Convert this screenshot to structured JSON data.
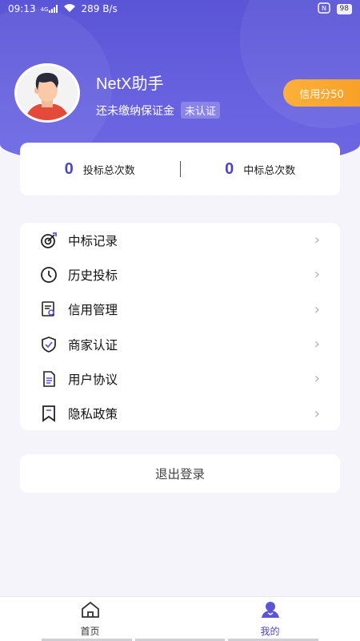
{
  "status_bar": {
    "time": "09:13",
    "signal_text": "4G",
    "net_speed": "289 B/s",
    "battery": "98"
  },
  "profile": {
    "username": "NetX助手",
    "deposit_status": "还未缴纳保证金",
    "verify_status": "未认证",
    "credit_label": "信用分50"
  },
  "stats": [
    {
      "value": "0",
      "label": "投标总次数"
    },
    {
      "value": "0",
      "label": "中标总次数"
    }
  ],
  "menu": [
    {
      "label": "中标记录",
      "icon": "target-icon"
    },
    {
      "label": "历史投标",
      "icon": "clock-icon"
    },
    {
      "label": "信用管理",
      "icon": "certificate-icon"
    },
    {
      "label": "商家认证",
      "icon": "shield-check-icon"
    },
    {
      "label": "用户协议",
      "icon": "document-icon"
    },
    {
      "label": "隐私政策",
      "icon": "bookmark-icon"
    }
  ],
  "logout_label": "退出登录",
  "tabs": [
    {
      "label": "首页",
      "icon": "home-icon",
      "active": false
    },
    {
      "label": "我的",
      "icon": "user-icon",
      "active": true
    }
  ],
  "colors": {
    "primary": "#5a55d6",
    "accent": "#4c47b7",
    "credit_orange": "#f7a128",
    "background": "#f4f4fa"
  }
}
